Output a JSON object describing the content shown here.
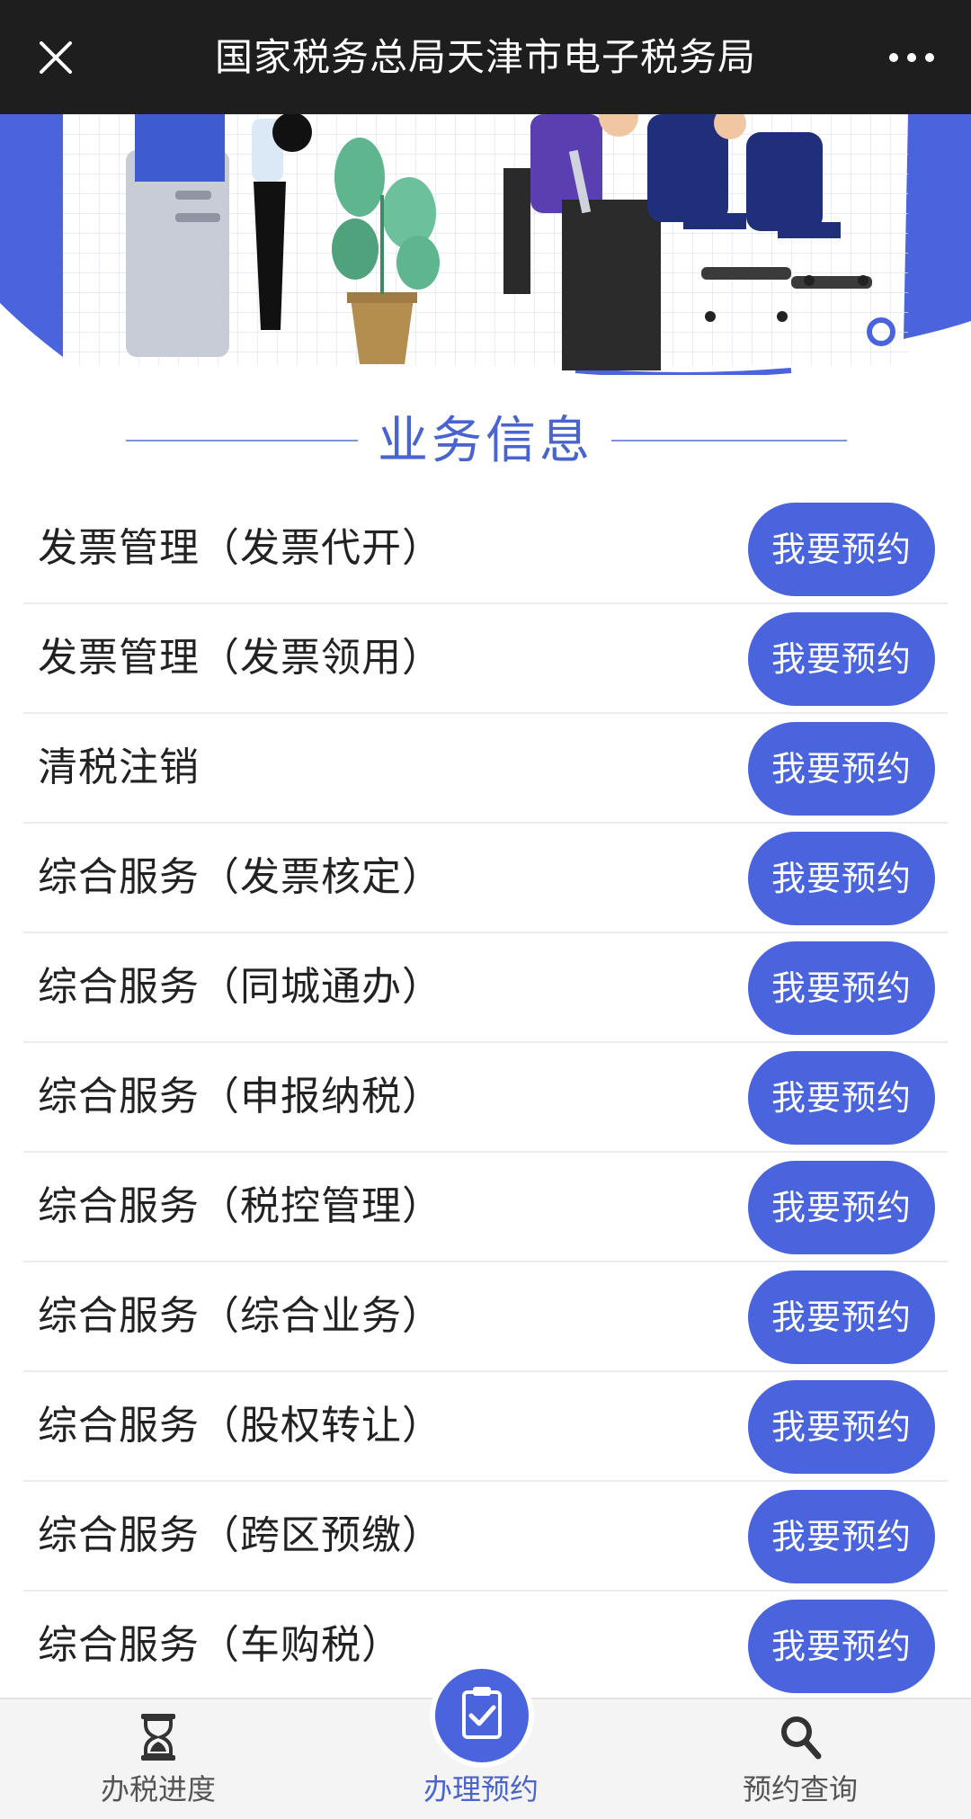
{
  "topbar": {
    "title": "国家税务总局天津市电子税务局",
    "close_icon": "close-icon",
    "more_icon": "more-icon"
  },
  "section": {
    "title": "业务信息"
  },
  "services": [
    {
      "name": "发票管理（发票代开）",
      "action": "我要预约"
    },
    {
      "name": "发票管理（发票领用）",
      "action": "我要预约"
    },
    {
      "name": "清税注销",
      "action": "我要预约"
    },
    {
      "name": "综合服务（发票核定）",
      "action": "我要预约"
    },
    {
      "name": "综合服务（同城通办）",
      "action": "我要预约"
    },
    {
      "name": "综合服务（申报纳税）",
      "action": "我要预约"
    },
    {
      "name": "综合服务（税控管理）",
      "action": "我要预约"
    },
    {
      "name": "综合服务（综合业务）",
      "action": "我要预约"
    },
    {
      "name": "综合服务（股权转让）",
      "action": "我要预约"
    },
    {
      "name": "综合服务（跨区预缴）",
      "action": "我要预约"
    },
    {
      "name": "综合服务（车购税）",
      "action": "我要预约"
    }
  ],
  "bottomnav": {
    "items": [
      {
        "label": "办税进度",
        "icon": "hourglass-icon",
        "active": false
      },
      {
        "label": "办理预约",
        "icon": "clipboard-check-icon",
        "active": true
      },
      {
        "label": "预约查询",
        "icon": "search-icon",
        "active": false
      }
    ]
  },
  "colors": {
    "accent": "#4a64dd",
    "topbar": "#1e1e1e",
    "text": "#222222"
  }
}
